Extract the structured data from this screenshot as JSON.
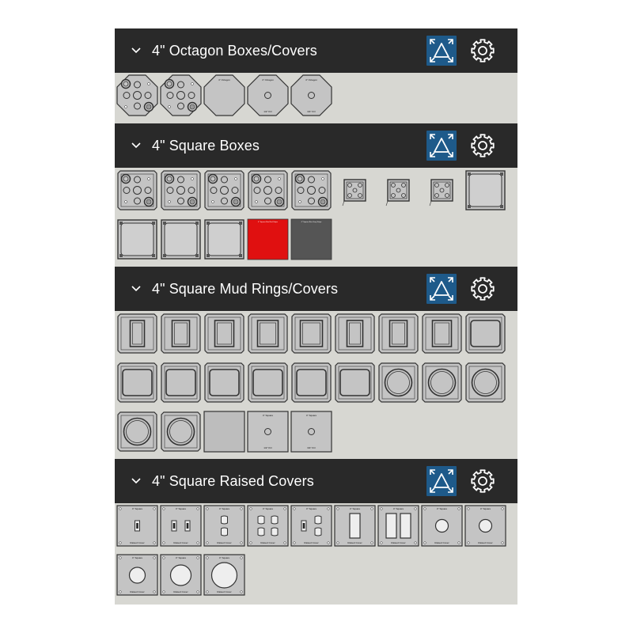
{
  "sections": [
    {
      "id": "octagon",
      "title": "4\" Octagon Boxes/Covers",
      "items": [
        {
          "kind": "oct-box"
        },
        {
          "kind": "oct-box"
        },
        {
          "kind": "oct-blank",
          "top_label": "4\" Octagon"
        },
        {
          "kind": "oct-hole",
          "top_label": "4\" Octagon",
          "bottom_label": "1/2\" KO"
        },
        {
          "kind": "oct-hole",
          "top_label": "4\" Octagon",
          "bottom_label": "3/4\" KO"
        }
      ]
    },
    {
      "id": "square-boxes",
      "title": "4\" Square Boxes",
      "items": [
        {
          "kind": "sq-box"
        },
        {
          "kind": "sq-box"
        },
        {
          "kind": "sq-box"
        },
        {
          "kind": "sq-box"
        },
        {
          "kind": "sq-box"
        },
        {
          "kind": "sq-mini"
        },
        {
          "kind": "sq-mini"
        },
        {
          "kind": "sq-mini"
        },
        {
          "kind": "sq-frame"
        },
        {
          "kind": "sq-frame"
        },
        {
          "kind": "sq-frame"
        },
        {
          "kind": "sq-frame"
        },
        {
          "kind": "sq-red",
          "color": "#e01010",
          "top_label": "4\" Square Box Red Stripe"
        },
        {
          "kind": "sq-grey",
          "color": "#555555",
          "top_label": "4\" Square Box Grey Stripe"
        }
      ]
    },
    {
      "id": "mud-rings",
      "title": "4\" Square Mud Rings/Covers",
      "items": [
        {
          "kind": "mud-1g",
          "w": 18
        },
        {
          "kind": "mud-1g",
          "w": 22
        },
        {
          "kind": "mud-1g",
          "w": 24
        },
        {
          "kind": "mud-1g",
          "w": 26
        },
        {
          "kind": "mud-1g",
          "w": 28
        },
        {
          "kind": "mud-1g",
          "w": 20
        },
        {
          "kind": "mud-1g",
          "w": 22
        },
        {
          "kind": "mud-1g",
          "w": 24
        },
        {
          "kind": "mud-2g"
        },
        {
          "kind": "mud-2g"
        },
        {
          "kind": "mud-2g"
        },
        {
          "kind": "mud-2g"
        },
        {
          "kind": "mud-2g"
        },
        {
          "kind": "mud-2g"
        },
        {
          "kind": "mud-2g"
        },
        {
          "kind": "mud-round"
        },
        {
          "kind": "mud-round"
        },
        {
          "kind": "mud-round"
        },
        {
          "kind": "mud-round"
        },
        {
          "kind": "mud-round"
        },
        {
          "kind": "mud-blank"
        },
        {
          "kind": "mud-ko",
          "top_label": "4\" Square",
          "bottom_label": "1/2\" KO"
        },
        {
          "kind": "mud-ko",
          "top_label": "4\" Square",
          "bottom_label": "3/4\" KO"
        }
      ]
    },
    {
      "id": "raised-covers",
      "title": "4\" Square Raised Covers",
      "items": [
        {
          "kind": "rc-toggle",
          "top_label": "4\" Square",
          "bottom_label": "Raised Cover"
        },
        {
          "kind": "rc-2toggle",
          "top_label": "4\" Square",
          "bottom_label": "Raised Cover"
        },
        {
          "kind": "rc-duplex",
          "top_label": "4\" Square",
          "bottom_label": "Raised Cover"
        },
        {
          "kind": "rc-2duplex",
          "top_label": "4\" Square",
          "bottom_label": "Raised Cover"
        },
        {
          "kind": "rc-tog-dup",
          "top_label": "4\" Square",
          "bottom_label": "Raised Cover"
        },
        {
          "kind": "rc-deco",
          "top_label": "4\" Square",
          "bottom_label": "Raised Cover"
        },
        {
          "kind": "rc-2deco",
          "top_label": "4\" Square",
          "bottom_label": "Raised Cover"
        },
        {
          "kind": "rc-single",
          "top_label": "4\" Square",
          "bottom_label": "Raised Cover"
        },
        {
          "kind": "rc-single",
          "top_label": "4\" Square",
          "bottom_label": "Raised Cover"
        },
        {
          "kind": "rc-round-s",
          "top_label": "4\" Square",
          "bottom_label": "Raised Cover"
        },
        {
          "kind": "rc-round-m",
          "top_label": "4\" Square",
          "bottom_label": "Raised Cover"
        },
        {
          "kind": "rc-round-l",
          "top_label": "4\" Square",
          "bottom_label": "Raised Cover"
        }
      ]
    }
  ],
  "colors": {
    "header_bg": "#292929",
    "panel_bg": "#d7d7d2",
    "accent": "#1e5a8a",
    "tile_fill": "#c4c4c4",
    "tile_stroke": "#333333"
  },
  "icons": {
    "collapse": "chevron-down-icon",
    "expand": "expand-arrows-icon",
    "settings": "gear-icon"
  }
}
